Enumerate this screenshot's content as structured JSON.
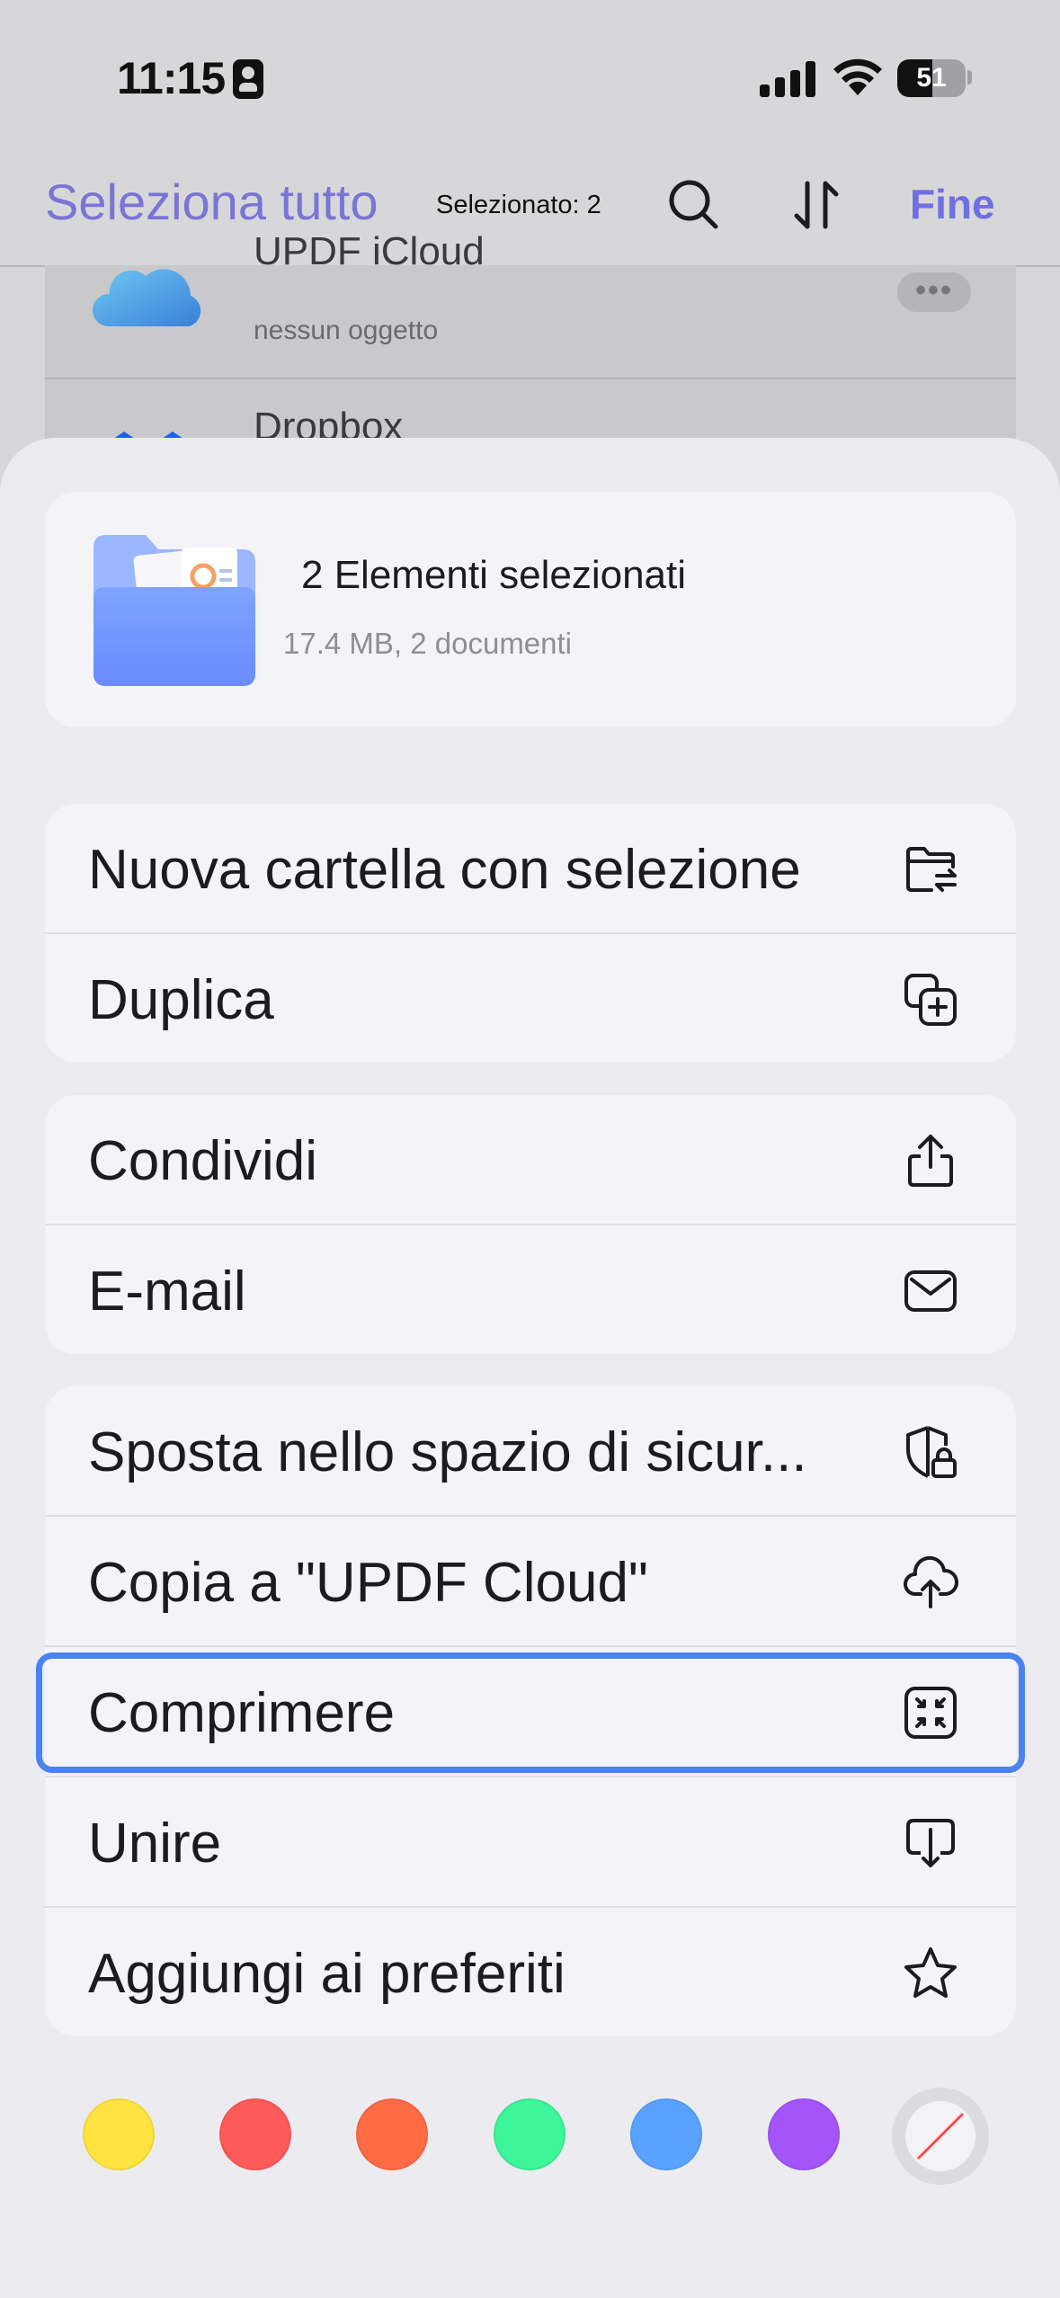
{
  "status_bar": {
    "time": "11:15",
    "battery": "51",
    "battery_level": 0.51
  },
  "nav": {
    "select_all": "Seleziona tutto",
    "selected_count": "Selezionato: 2",
    "done": "Fine"
  },
  "background_list": [
    {
      "title": "UPDF iCloud",
      "subtitle": "nessun oggetto"
    },
    {
      "title": "Dropbox"
    }
  ],
  "summary": {
    "title": "2 Elementi selezionati",
    "subtitle": "17.4 MB, 2 documenti"
  },
  "groups": [
    [
      {
        "label": "Nuova cartella con selezione",
        "icon": "folder-move-icon"
      },
      {
        "label": "Duplica",
        "icon": "duplicate-icon"
      }
    ],
    [
      {
        "label": "Condividi",
        "icon": "share-icon"
      },
      {
        "label": "E-mail",
        "icon": "mail-icon"
      }
    ],
    [
      {
        "label": "Sposta nello spazio di sicur...",
        "icon": "shield-lock-icon"
      },
      {
        "label": "Copia a \"UPDF Cloud\"",
        "icon": "cloud-upload-icon"
      },
      {
        "label": "Comprimere",
        "icon": "compress-icon",
        "highlighted": true
      },
      {
        "label": "Unire",
        "icon": "merge-icon"
      },
      {
        "label": "Aggiungi ai preferiti",
        "icon": "star-icon"
      }
    ]
  ],
  "color_swatches": [
    "#FFE341",
    "#FF5A5A",
    "#FF6B45",
    "#3DF59A",
    "#5AA2FF",
    "#A455FA"
  ],
  "colors": {
    "accent": "#7B74D6",
    "highlight": "#4A83F0"
  }
}
